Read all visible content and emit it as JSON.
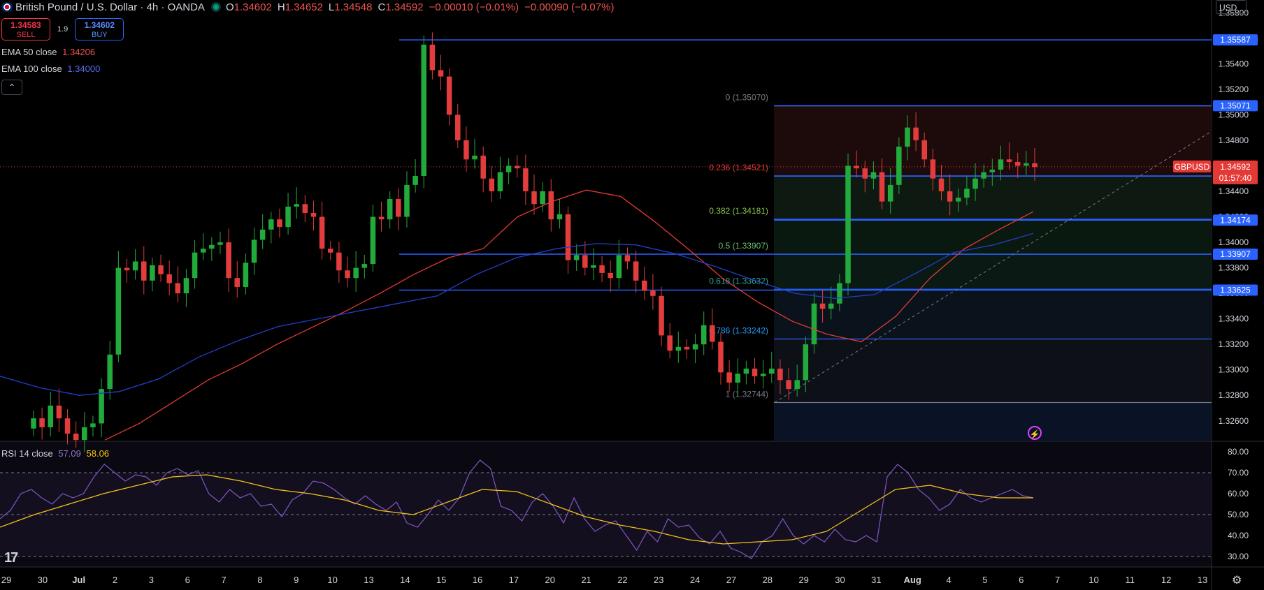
{
  "header": {
    "title": "British Pound / U.S. Dollar · 4h · OANDA",
    "open_label": "O",
    "open": "1.34602",
    "high_label": "H",
    "high": "1.34652",
    "low_label": "L",
    "low": "1.34548",
    "close_label": "C",
    "close": "1.34592",
    "change": "−0.00010 (−0.01%)",
    "change2": "−0.00090 (−0.07%)"
  },
  "trade": {
    "sell_price": "1.34583",
    "sell_label": "SELL",
    "spread": "1.9",
    "buy_price": "1.34602",
    "buy_label": "BUY"
  },
  "indicators": {
    "ema50_label": "EMA 50 close",
    "ema50_value": "1.34206",
    "ema100_label": "EMA 100 close",
    "ema100_value": "1.34000",
    "rsi_label": "RSI 14 close",
    "rsi_value": "57.09",
    "rsi_ma_value": "58.06"
  },
  "currency": "USD",
  "logo": "17",
  "colors": {
    "up": "#22ab3c",
    "down": "#e33c3c",
    "ema50": "#e53935",
    "ema100": "#2140c8",
    "level": "#2962ff",
    "rsi": "#7e57c2",
    "rsi_ma": "#f5c518"
  },
  "chart_data": {
    "type": "candlestick",
    "symbol": "GBPUSD",
    "timeframe": "4h",
    "price_axis": [
      "1.35800",
      "1.35600",
      "1.35400",
      "1.35200",
      "1.35000",
      "1.34800",
      "1.34600",
      "1.34400",
      "1.34200",
      "1.34000",
      "1.33800",
      "1.33600",
      "1.33400",
      "1.33200",
      "1.33000",
      "1.32800",
      "1.32600"
    ],
    "ylim": [
      1.3244,
      1.359
    ],
    "time_axis": [
      "29",
      "30",
      "Jul",
      "2",
      "3",
      "6",
      "7",
      "8",
      "9",
      "10",
      "13",
      "14",
      "15",
      "16",
      "17",
      "20",
      "21",
      "22",
      "23",
      "24",
      "27",
      "28",
      "29",
      "30",
      "31",
      "Aug",
      "4",
      "5",
      "6",
      "7",
      "10",
      "11",
      "12",
      "13"
    ],
    "price_tags": [
      {
        "label": "1.35587",
        "price": 1.35587
      },
      {
        "label": "1.35071",
        "price": 1.35071
      },
      {
        "label": "1.34519",
        "price": 1.34519
      },
      {
        "label": "1.34174",
        "price": 1.34174
      },
      {
        "label": "1.33907",
        "price": 1.33907
      },
      {
        "label": "1.33625",
        "price": 1.33625
      }
    ],
    "current": {
      "symbol": "GBPUSD",
      "price": "1.34592",
      "countdown": "01:57:40",
      "value": 1.34592
    },
    "fibonacci": [
      {
        "label": "0 (1.35070)",
        "value": 1.3507
      },
      {
        "label": "0.236 (1.34521)",
        "value": 1.34521
      },
      {
        "label": "0.382 (1.34181)",
        "value": 1.34181
      },
      {
        "label": "0.5 (1.33907)",
        "value": 1.33907
      },
      {
        "label": "0.618 (1.33632)",
        "value": 1.33632
      },
      {
        "label": "0.786 (1.33242)",
        "value": 1.33242
      },
      {
        "label": "1 (1.32744)",
        "value": 1.32744
      }
    ],
    "close_series": [
      1.3262,
      1.3255,
      1.3272,
      1.3262,
      1.325,
      1.3245,
      1.3255,
      1.3258,
      1.3285,
      1.3312,
      1.338,
      1.3378,
      1.3385,
      1.337,
      1.3382,
      1.3375,
      1.3368,
      1.336,
      1.3372,
      1.3392,
      1.3395,
      1.3398,
      1.34,
      1.3372,
      1.3365,
      1.3384,
      1.3402,
      1.341,
      1.3418,
      1.3412,
      1.3428,
      1.343,
      1.3423,
      1.342,
      1.3395,
      1.3392,
      1.3378,
      1.3372,
      1.338,
      1.3383,
      1.342,
      1.3418,
      1.3434,
      1.342,
      1.3445,
      1.3452,
      1.3555,
      1.3535,
      1.353,
      1.35,
      1.348,
      1.3465,
      1.3468,
      1.345,
      1.344,
      1.3455,
      1.346,
      1.3458,
      1.344,
      1.343,
      1.344,
      1.3418,
      1.3422,
      1.3386,
      1.339,
      1.338,
      1.3382,
      1.3376,
      1.3372,
      1.339,
      1.3385,
      1.337,
      1.3362,
      1.3358,
      1.3327,
      1.3315,
      1.3318,
      1.3316,
      1.332,
      1.3335,
      1.3322,
      1.3298,
      1.329,
      1.3297,
      1.3301,
      1.3295,
      1.3297,
      1.3301,
      1.3292,
      1.3285,
      1.3292,
      1.332,
      1.3352,
      1.3348,
      1.3352,
      1.3368,
      1.346,
      1.3458,
      1.345,
      1.3455,
      1.3432,
      1.3445,
      1.3475,
      1.349,
      1.348,
      1.3465,
      1.345,
      1.344,
      1.3432,
      1.3435,
      1.3442,
      1.345,
      1.3455,
      1.3457,
      1.3465,
      1.3463,
      1.346,
      1.3462,
      1.3459
    ],
    "ema50_series": [
      1.3245,
      1.3258,
      1.3275,
      1.3292,
      1.3305,
      1.332,
      1.3333,
      1.3346,
      1.336,
      1.3375,
      1.3388,
      1.3395,
      1.342,
      1.3432,
      1.3441,
      1.3436,
      1.3416,
      1.3394,
      1.3371,
      1.3353,
      1.3338,
      1.3328,
      1.3322,
      1.3342,
      1.3372,
      1.3395,
      1.341,
      1.3424
    ],
    "ema100_series": [
      1.3295,
      1.3286,
      1.328,
      1.3283,
      1.3293,
      1.331,
      1.3323,
      1.3334,
      1.334,
      1.3346,
      1.3352,
      1.3358,
      1.3375,
      1.3388,
      1.3395,
      1.3399,
      1.3398,
      1.3391,
      1.3381,
      1.337,
      1.336,
      1.3356,
      1.3359,
      1.3375,
      1.3392,
      1.3398,
      1.3407
    ],
    "rsi": {
      "levels": [
        "80.00",
        "70.00",
        "60.00",
        "50.00",
        "40.00",
        "30.00"
      ],
      "ylim": [
        25,
        85
      ],
      "bands": [
        30,
        50,
        70
      ]
    },
    "rsi_series": [
      48,
      52,
      60,
      62,
      58,
      55,
      60,
      58,
      60,
      68,
      74,
      70,
      66,
      69,
      68,
      64,
      70,
      72,
      69,
      71,
      60,
      56,
      62,
      58,
      60,
      54,
      55,
      49,
      57,
      60,
      66,
      65,
      62,
      58,
      55,
      59,
      55,
      52,
      56,
      46,
      44,
      50,
      57,
      52,
      58,
      70,
      76,
      72,
      54,
      52,
      47,
      56,
      60,
      54,
      46,
      58,
      48,
      42,
      45,
      47,
      40,
      33,
      42,
      37,
      48,
      44,
      45,
      39,
      36,
      42,
      34,
      32,
      29,
      37,
      40,
      48,
      40,
      36,
      40,
      37,
      43,
      38,
      37,
      40,
      37,
      68,
      74,
      70,
      62,
      58,
      52,
      55,
      62,
      58,
      56,
      58,
      60,
      62,
      59,
      58
    ],
    "rsi_ma_series": [
      44,
      50,
      55,
      60,
      64,
      68,
      69,
      66,
      62,
      60,
      57,
      52,
      50,
      56,
      62,
      61,
      55,
      49,
      45,
      42,
      38,
      36,
      37,
      38,
      42,
      52,
      62,
      64,
      60,
      58,
      58
    ]
  }
}
